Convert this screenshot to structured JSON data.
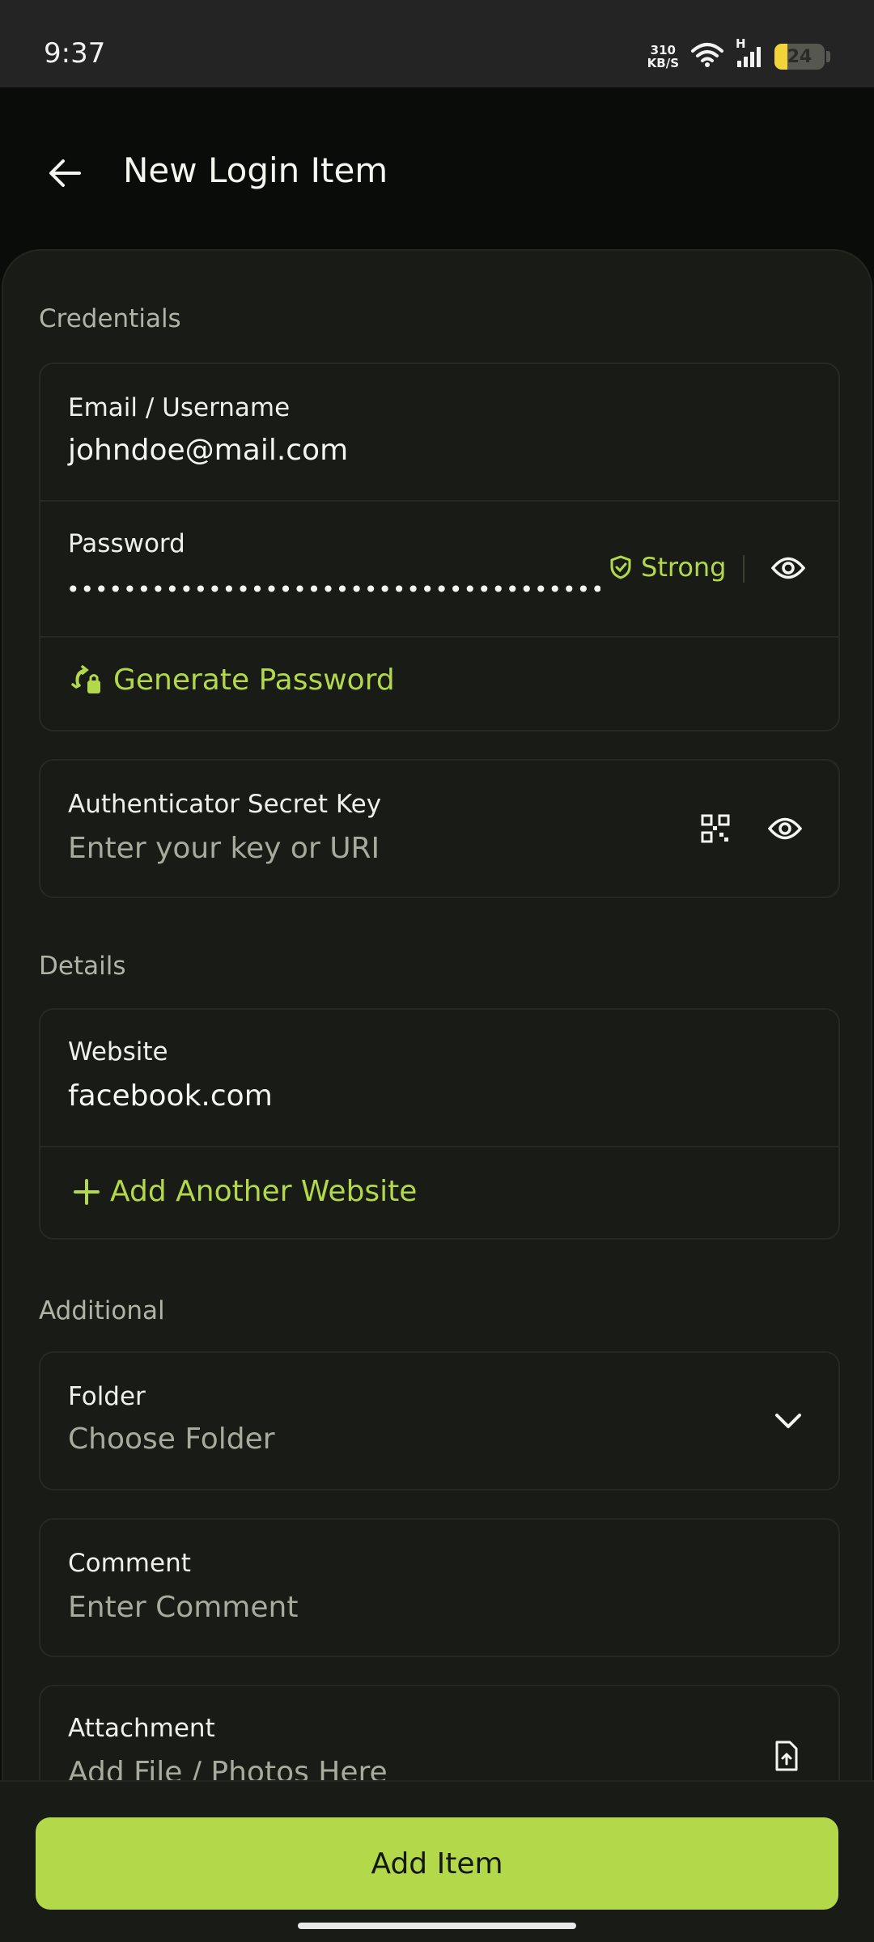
{
  "status_bar": {
    "time": "9:37",
    "net_speed_value": "310",
    "net_speed_unit": "KB/S",
    "network_type": "H",
    "battery_level": "24"
  },
  "header": {
    "title": "New Login Item"
  },
  "sections": {
    "credentials": "Credentials",
    "details": "Details",
    "additional": "Additional"
  },
  "credentials": {
    "email_label": "Email / Username",
    "email_value": "johndoe@mail.com",
    "password_label": "Password",
    "password_mask": "••••••••••••••••••••••••••••••••••••••••",
    "strength": "Strong",
    "generate_label": "Generate Password",
    "auth_label": "Authenticator Secret Key",
    "auth_placeholder": "Enter your key or URI"
  },
  "details": {
    "website_label": "Website",
    "website_value": "facebook.com",
    "add_website_label": "Add Another Website"
  },
  "additional": {
    "folder_label": "Folder",
    "folder_placeholder": "Choose Folder",
    "comment_label": "Comment",
    "comment_placeholder": "Enter Comment",
    "attachment_label": "Attachment",
    "attachment_placeholder": "Add File / Photos Here"
  },
  "footer": {
    "add_item_label": "Add Item"
  },
  "colors": {
    "accent": "#b3d94a",
    "background": "#0a0c09",
    "surface": "#191b16"
  }
}
